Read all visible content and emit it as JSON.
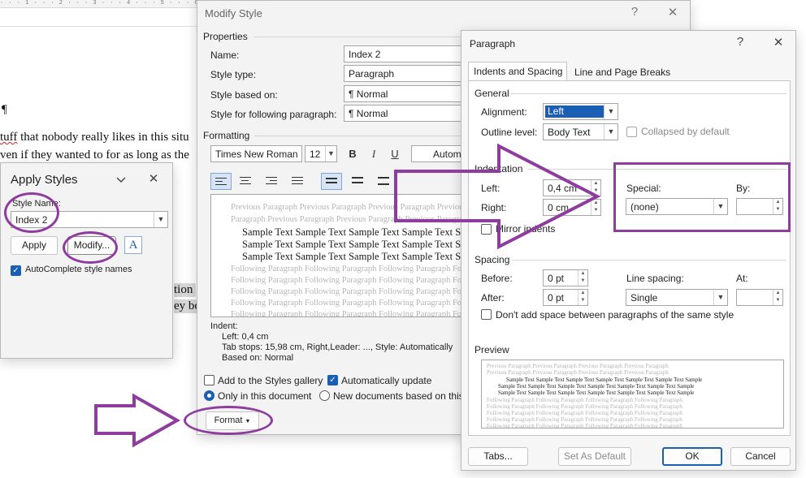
{
  "document": {
    "ruler_text": "· · · 1 · · · 2 · · · 3 · · · 4 · · · 5 · · · 6 · · · 7 · · ·",
    "pilcrow_line": "¶",
    "line1_a": "tuff",
    "line1_b": "that nobody really likes in this situ",
    "line2": "ven if they wanted to for as long as the",
    "line3": "tion",
    "line4": "ey bo"
  },
  "apply_styles": {
    "title": "Apply Styles",
    "style_name_label": "Style Name:",
    "style_name_value": "Index 2",
    "apply_label": "Apply",
    "modify_label": "Modify...",
    "styles_pane_icon_label": "A",
    "autocomplete_label": "AutoComplete style names"
  },
  "modify_style": {
    "title": "Modify Style",
    "help_glyph": "?",
    "close_glyph": "✕",
    "properties_label": "Properties",
    "name_label": "Name:",
    "name_value": "Index 2",
    "style_type_label": "Style type:",
    "style_type_value": "Paragraph",
    "based_on_label": "Style based on:",
    "based_on_value": "¶  Normal",
    "following_label": "Style for following paragraph:",
    "following_value": "¶  Normal",
    "formatting_label": "Formatting",
    "font_value": "Times New Roman",
    "size_value": "12",
    "bold_glyph": "B",
    "italic_glyph": "I",
    "underline_glyph": "U",
    "color_value": "Automa",
    "preview_prev1": "Previous Paragraph Previous Paragraph Previous Paragraph Previous Paragraph",
    "preview_prev2": "Paragraph Previous Paragraph Previous Paragraph Previous Paragraph",
    "preview_sample": "Sample Text Sample Text Sample Text Sample Text Sample Text",
    "preview_follow": "Following Paragraph Following Paragraph Following Paragraph Following Paragraph",
    "desc_line1": "Indent:",
    "desc_line2": "Left:  0,4 cm",
    "desc_line3": "Tab stops:  15,98 cm, Right,Leader: ..., Style: Automatically",
    "desc_line4": "Based on: Normal",
    "add_gallery_label": "Add to the Styles gallery",
    "auto_update_label": "Automatically update",
    "only_doc_label": "Only in this document",
    "new_docs_label": "New documents based on this",
    "format_label": "Format"
  },
  "paragraph": {
    "title": "Paragraph",
    "help_glyph": "?",
    "close_glyph": "✕",
    "tab_indents": "Indents and Spacing",
    "tab_breaks": "Line and Page Breaks",
    "general_label": "General",
    "alignment_label": "Alignment:",
    "alignment_value": "Left",
    "outline_label": "Outline level:",
    "outline_value": "Body Text",
    "collapsed_label": "Collapsed by default",
    "indentation_label": "Indentation",
    "left_label": "Left:",
    "left_value": "0,4 cm",
    "right_label": "Right:",
    "right_value": "0 cm",
    "special_label": "Special:",
    "special_value": "(none)",
    "by_label": "By:",
    "by_value": "",
    "mirror_label": "Mirror indents",
    "spacing_label": "Spacing",
    "before_label": "Before:",
    "before_value": "0 pt",
    "after_label": "After:",
    "after_value": "0 pt",
    "line_spacing_label": "Line spacing:",
    "line_spacing_value": "Single",
    "at_label": "At:",
    "at_value": "",
    "dont_add_label": "Don't add space between paragraphs of the same style",
    "preview_label": "Preview",
    "pv_prev": "Previous Paragraph Previous Paragraph Previous Paragraph Previous Paragraph",
    "pv_sample": "Sample Text Sample Text Sample Text Sample Text Sample Text Sample Text Sample",
    "pv_follow": "Following Paragraph Following Paragraph Following Paragraph Following Paragraph",
    "tabs_label": "Tabs...",
    "set_default_label": "Set As Default",
    "ok_label": "OK",
    "cancel_label": "Cancel"
  },
  "colors": {
    "annotation_purple": "#8e3c9e",
    "accent_blue": "#1a5fb4"
  }
}
